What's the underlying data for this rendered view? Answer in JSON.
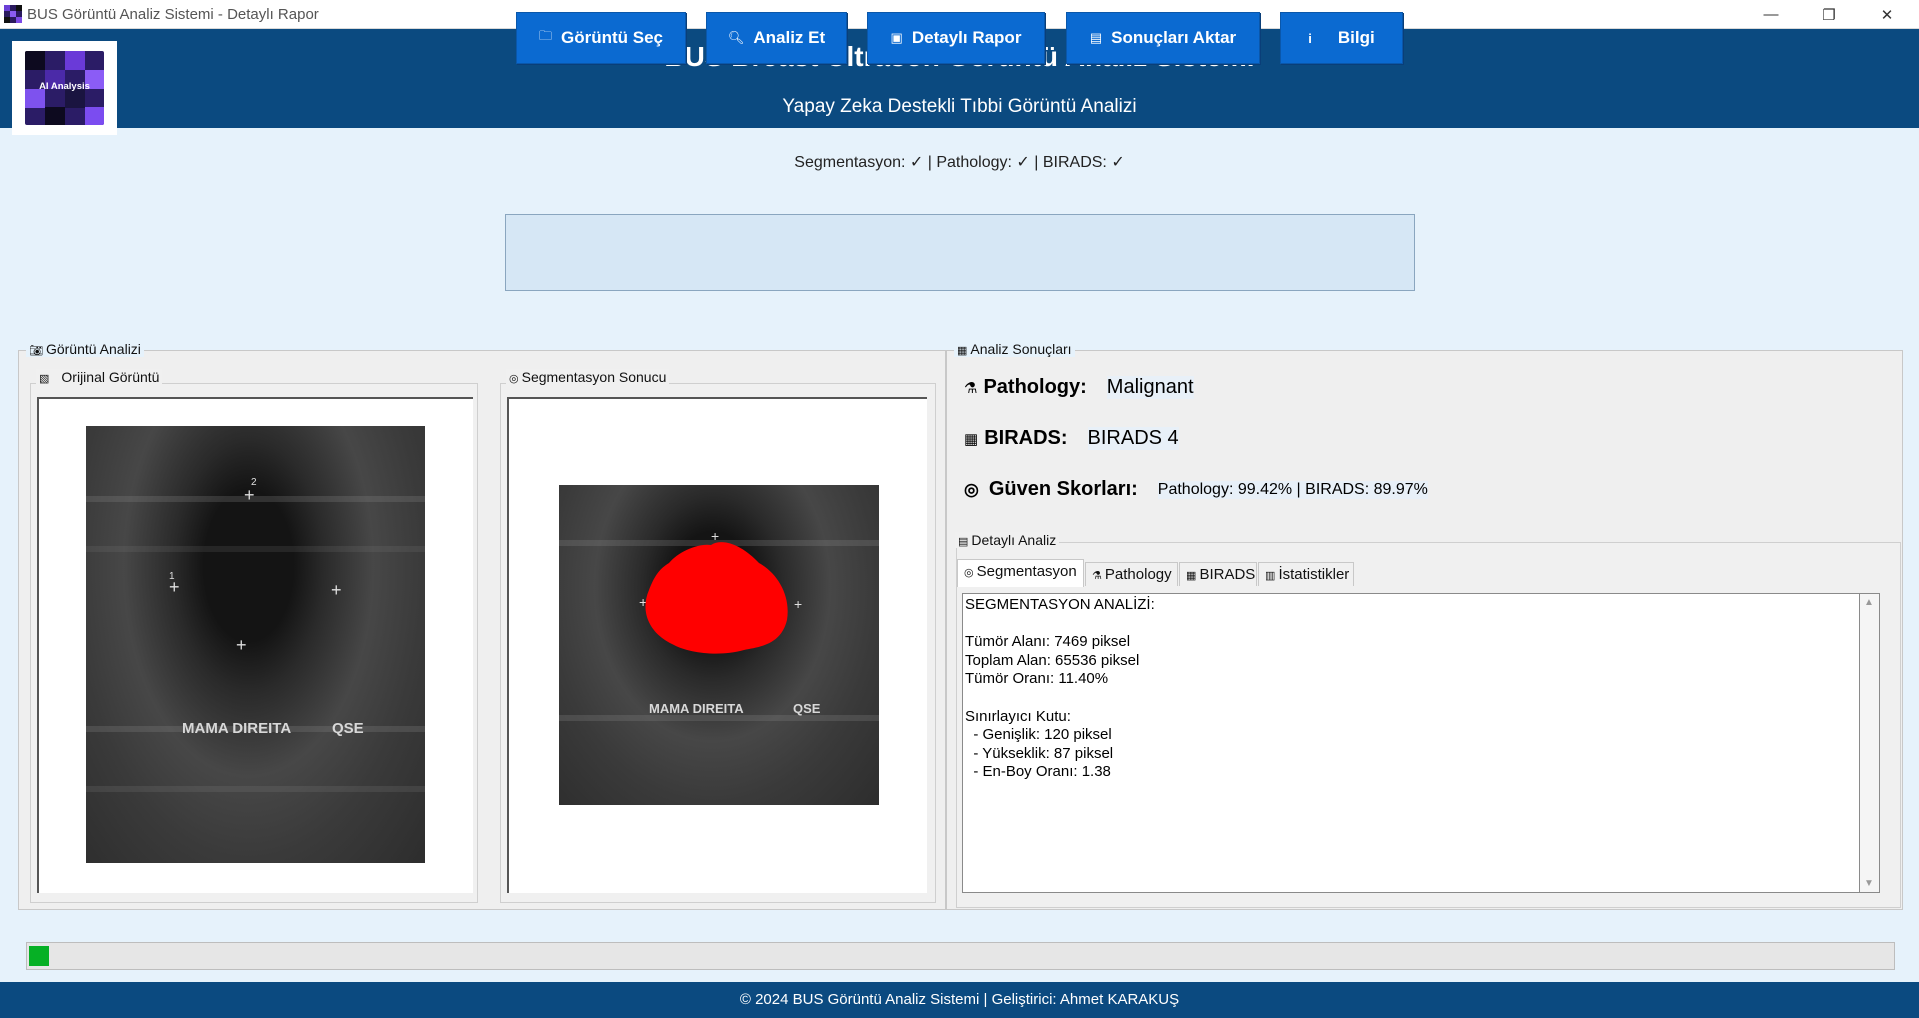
{
  "window": {
    "title": "BUS Görüntü Analiz Sistemi - Detaylı Rapor",
    "minimize_glyph": "—",
    "restore_glyph": "❐",
    "close_glyph": "✕"
  },
  "header": {
    "logo_text": "AI Analysis",
    "title": "BUS Breast Ultrason Görüntü Analiz Sistemi",
    "subtitle": "Yapay Zeka Destekli Tıbbi Görüntü Analizi"
  },
  "status_line": "Segmentasyon: ✓ | Pathology: ✓ | BIRADS: ✓",
  "toolbar": {
    "select_image": "Görüntü Seç",
    "analyze": "Analiz Et",
    "detailed_report": "Detaylı Rapor",
    "export_results": "Sonuçları Aktar",
    "info": "Bilgi"
  },
  "image_analysis": {
    "group_title": "Görüntü Analizi",
    "original_title": "Orijinal Görüntü",
    "segmentation_title": "Segmentasyon Sonucu",
    "ultrasound_label_left": "MAMA DIREITA",
    "ultrasound_label_right": "QSE"
  },
  "results": {
    "group_title": "Analiz Sonuçları",
    "pathology_label": "Pathology:",
    "pathology_value": "Malignant",
    "birads_label": "BIRADS:",
    "birads_value": "BIRADS 4",
    "confidence_label": "Güven Skorları:",
    "confidence_value": "Pathology: 99.42% | BIRADS: 89.97%"
  },
  "detail": {
    "group_title": "Detaylı Analiz",
    "tabs": [
      "Segmentasyon",
      "Pathology",
      "BIRADS",
      "İstatistikler"
    ],
    "active_tab": "Segmentasyon",
    "text": "SEGMENTASYON ANALİZİ:\n\nTümör Alanı: 7469 piksel\nToplam Alan: 65536 piksel\nTümör Oranı: 11.40%\n\nSınırlayıcı Kutu:\n  - Genişlik: 120 piksel\n  - Yükseklik: 87 piksel\n  - En-Boy Oranı: 1.38"
  },
  "progress": {
    "value": 0.01,
    "color": "#06b025"
  },
  "footer": "© 2024 BUS Görüntü Analiz Sistemi | Geliştirici: Ahmet KARAKUŞ",
  "colors": {
    "header_bg": "#0b4a80",
    "button_bg": "#0b6ad1",
    "mask": "#ff0000",
    "page_bg": "#e6f2fb"
  }
}
